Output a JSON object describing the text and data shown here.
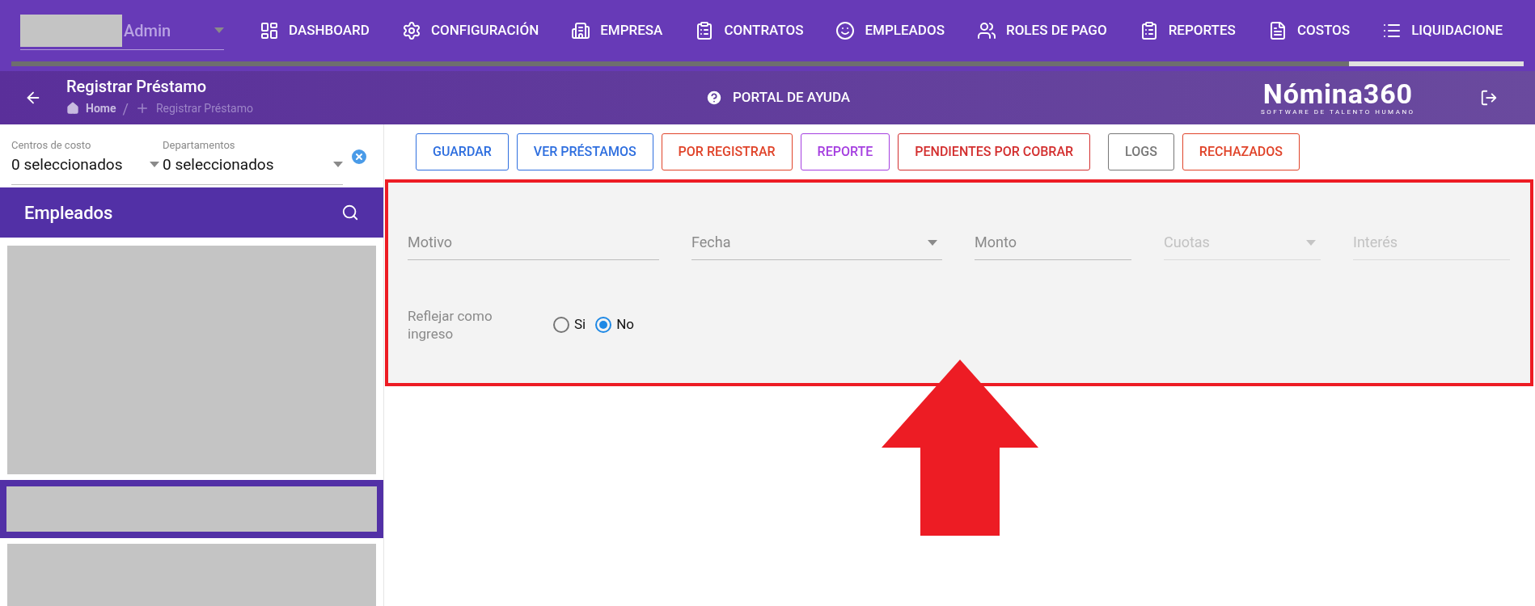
{
  "user_menu": {
    "label": "Admin"
  },
  "nav": [
    {
      "label": "DASHBOARD",
      "kind": "dashboard"
    },
    {
      "label": "CONFIGURACIÓN",
      "kind": "settings"
    },
    {
      "label": "EMPRESA",
      "kind": "building"
    },
    {
      "label": "CONTRATOS",
      "kind": "clipboard"
    },
    {
      "label": "EMPLEADOS",
      "kind": "face"
    },
    {
      "label": "ROLES DE PAGO",
      "kind": "people"
    },
    {
      "label": "REPORTES",
      "kind": "clipboard"
    },
    {
      "label": "COSTOS",
      "kind": "invoice"
    },
    {
      "label": "LIQUIDACIONE",
      "kind": "list"
    }
  ],
  "header": {
    "title": "Registrar Préstamo",
    "breadcrumb": [
      {
        "label": "Home",
        "kind": "home"
      },
      {
        "label": "Registrar Préstamo",
        "kind": "plus",
        "separator": "/"
      }
    ],
    "help": "PORTAL DE AYUDA",
    "logo": {
      "name": "Nómina360",
      "tagline": "SOFTWARE DE TALENTO HUMANO"
    }
  },
  "filters": [
    {
      "label": "Centros de costo",
      "value": "0 seleccionados"
    },
    {
      "label": "Departamentos",
      "value": "0 seleccionados"
    }
  ],
  "employees": {
    "title": "Empleados",
    "items": [
      {
        "selected": false
      },
      {
        "selected": true
      },
      {
        "selected": false
      }
    ]
  },
  "buttons": [
    {
      "label": "GUARDAR",
      "color": "#2f6fdf"
    },
    {
      "label": "VER PRÉSTAMOS",
      "color": "#2f6fdf"
    },
    {
      "label": "POR REGISTRAR",
      "color": "#e0442a"
    },
    {
      "label": "REPORTE",
      "color": "#a53fe0"
    },
    {
      "label": "PENDIENTES POR COBRAR",
      "color": "#d32f2f"
    },
    {
      "label": "LOGS",
      "color": "#777777"
    },
    {
      "label": "RECHAZADOS",
      "color": "#e0442a"
    }
  ],
  "form": {
    "fields": [
      {
        "placeholder": "Motivo",
        "kind": "text",
        "disabled": false
      },
      {
        "placeholder": "Fecha",
        "kind": "select",
        "disabled": false
      },
      {
        "placeholder": "Monto",
        "kind": "text",
        "disabled": false
      },
      {
        "placeholder": "Cuotas",
        "kind": "select",
        "disabled": true
      },
      {
        "placeholder": "Interés",
        "kind": "text",
        "disabled": true
      }
    ],
    "radio": {
      "label": "Reflejar como ingreso",
      "options": [
        {
          "label": "Si",
          "selected": false
        },
        {
          "label": "No",
          "selected": true
        }
      ]
    }
  }
}
